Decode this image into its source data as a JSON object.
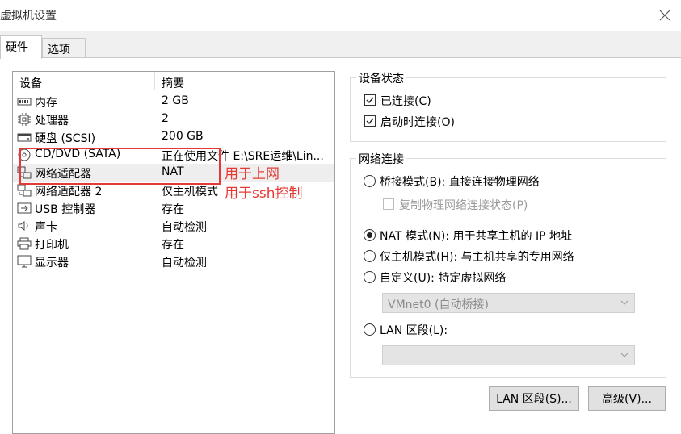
{
  "window": {
    "title": "虚拟机设置",
    "close_glyph": "✕"
  },
  "tabs": [
    {
      "label": "硬件"
    },
    {
      "label": "选项"
    }
  ],
  "device_list": {
    "headers": {
      "device": "设备",
      "summary": "摘要"
    },
    "rows": [
      {
        "icon": "memory-icon",
        "name": "内存",
        "summary": "2 GB"
      },
      {
        "icon": "cpu-icon",
        "name": "处理器",
        "summary": "2"
      },
      {
        "icon": "harddisk-icon",
        "name": "硬盘 (SCSI)",
        "summary": "200 GB"
      },
      {
        "icon": "cd-icon",
        "name": "CD/DVD (SATA)",
        "summary": "正在使用文件 E:\\SRE运维\\Lin..."
      },
      {
        "icon": "network-icon",
        "name": "网络适配器",
        "summary": "NAT"
      },
      {
        "icon": "network-icon",
        "name": "网络适配器 2",
        "summary": "仅主机模式"
      },
      {
        "icon": "usb-icon",
        "name": "USB 控制器",
        "summary": "存在"
      },
      {
        "icon": "speaker-icon",
        "name": "声卡",
        "summary": "自动检测"
      },
      {
        "icon": "printer-icon",
        "name": "打印机",
        "summary": "存在"
      },
      {
        "icon": "monitor-icon",
        "name": "显示器",
        "summary": "自动检测"
      }
    ],
    "selected_index": 4
  },
  "annotations": {
    "first": "用于上网",
    "second": "用于ssh控制",
    "color": "#e53935"
  },
  "device_status": {
    "title": "设备状态",
    "connected": {
      "label": "已连接(C)",
      "checked": true
    },
    "connect_at_power_on": {
      "label": "启动时连接(O)",
      "checked": true
    }
  },
  "network_connection": {
    "title": "网络连接",
    "bridged": {
      "label": "桥接模式(B): 直接连接物理网络",
      "selected": false
    },
    "replicate": {
      "label": "复制物理网络连接状态(P)",
      "checked": false,
      "enabled": false
    },
    "nat": {
      "label": "NAT 模式(N): 用于共享主机的 IP 地址",
      "selected": true
    },
    "host_only": {
      "label": "仅主机模式(H): 与主机共享的专用网络",
      "selected": false
    },
    "custom": {
      "label": "自定义(U): 特定虚拟网络",
      "selected": false
    },
    "custom_select": {
      "value": "VMnet0 (自动桥接)"
    },
    "lan_segment": {
      "label": "LAN 区段(L):",
      "selected": false
    },
    "lan_select": {
      "value": ""
    }
  },
  "buttons": {
    "lan_segments": "LAN 区段(S)...",
    "advanced": "高级(V)..."
  }
}
